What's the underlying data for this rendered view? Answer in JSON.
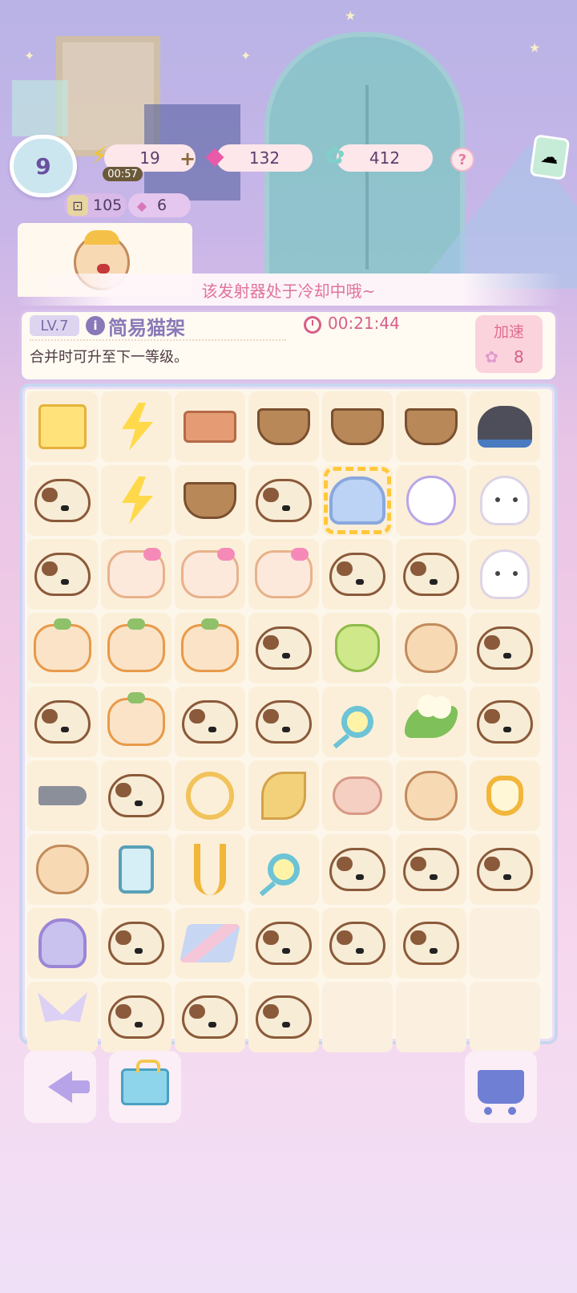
{
  "hud": {
    "player_level": "9",
    "energy": "19",
    "energy_plus": "+",
    "energy_timer": "00:57",
    "gems": "132",
    "stars": "412",
    "help": "?",
    "coins": "105",
    "tickets": "6"
  },
  "toast": "该发射器处于冷却中哦~",
  "selected_item": {
    "level": "LV.7",
    "info": "i",
    "name": "简易猫架",
    "countdown": "00:21:44",
    "description": "合并时可升至下一等级。",
    "speed_up_label": "加速",
    "speed_up_cost": "8"
  },
  "board": {
    "rows": [
      [
        "giftbox-bolt",
        "double-bolt",
        "bricks",
        "lemon-basket",
        "basket",
        "basket",
        "black-cat-box"
      ],
      [
        "siamese-cat",
        "double-bolt",
        "basket",
        "siamese-cat",
        "cat-scanner",
        "white-cat",
        "ghost"
      ],
      [
        "siamese-cat",
        "pink-bow-cat",
        "pink-bow-cat",
        "pink-bow-cat",
        "siamese-cat",
        "siamese-cat",
        "ghost"
      ],
      [
        "orange-letter-cat",
        "orange-letter-cat",
        "orange-letter-cat",
        "siamese-cat",
        "coin-bag",
        "baby-hamster",
        "siamese-cat"
      ],
      [
        "siamese-cat",
        "orange-letter-cat",
        "siamese-cat",
        "siamese-cat",
        "magnifier",
        "eggs-on-leaf",
        "siamese-cat"
      ],
      [
        "fish",
        "siamese-cat",
        "paw-rope",
        "leaf-bundle",
        "sausage-roll",
        "diaper-hamster",
        "heart-racket"
      ],
      [
        "reading-hamster",
        "thread-spool",
        "tongs",
        "magnifier",
        "siamese-cat",
        "siamese-cat",
        "siamese-cat"
      ],
      [
        "pet-gadget",
        "siamese-cat",
        "blanket",
        "siamese-cat",
        "siamese-cat",
        "siamese-cat",
        "empty"
      ],
      [
        "butterfly",
        "siamese-cat",
        "siamese-cat",
        "siamese-cat",
        "empty",
        "empty",
        "empty"
      ]
    ],
    "selected_cell": "cat-scanner"
  },
  "bottom": {
    "back": "back-arrow-icon",
    "toolbox": "toolbox-icon",
    "shop": "cart-icon"
  }
}
